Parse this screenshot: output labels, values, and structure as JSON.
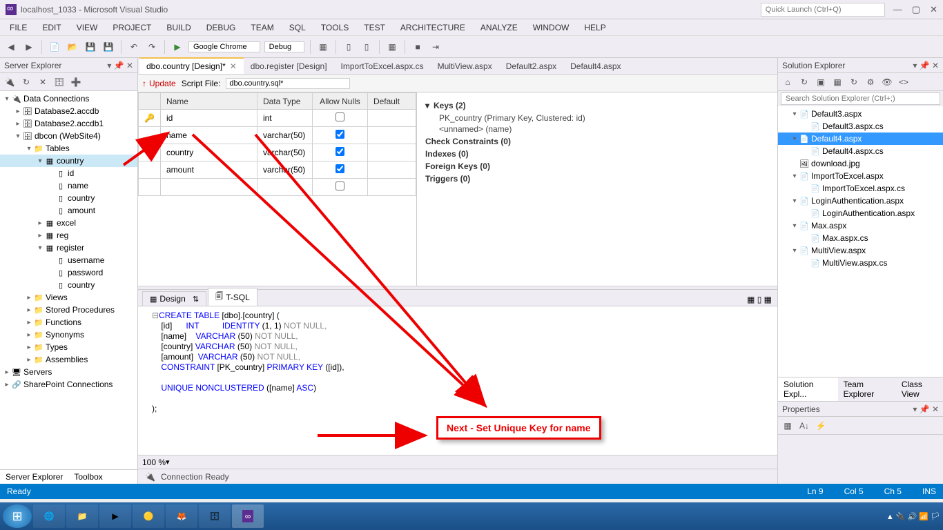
{
  "title": "localhost_1033 - Microsoft Visual Studio",
  "quickLaunch": "Quick Launch (Ctrl+Q)",
  "menu": [
    "FILE",
    "EDIT",
    "VIEW",
    "PROJECT",
    "BUILD",
    "DEBUG",
    "TEAM",
    "SQL",
    "TOOLS",
    "TEST",
    "ARCHITECTURE",
    "ANALYZE",
    "WINDOW",
    "HELP"
  ],
  "runTarget": "Google Chrome",
  "config": "Debug",
  "leftPanel": {
    "title": "Server Explorer",
    "tabs": [
      "Server Explorer",
      "Toolbox"
    ],
    "tree": [
      {
        "d": 0,
        "exp": "▾",
        "ico": "🔌",
        "t": "Data Connections"
      },
      {
        "d": 1,
        "exp": "▸",
        "ico": "🗄",
        "t": "Database2.accdb"
      },
      {
        "d": 1,
        "exp": "▸",
        "ico": "🗄",
        "t": "Database2.accdb1"
      },
      {
        "d": 1,
        "exp": "▾",
        "ico": "🗄",
        "t": "dbcon (WebSite4)"
      },
      {
        "d": 2,
        "exp": "▾",
        "ico": "📁",
        "t": "Tables"
      },
      {
        "d": 3,
        "exp": "▾",
        "ico": "▦",
        "t": "country",
        "sel": true
      },
      {
        "d": 4,
        "exp": "",
        "ico": "▯",
        "t": "id"
      },
      {
        "d": 4,
        "exp": "",
        "ico": "▯",
        "t": "name"
      },
      {
        "d": 4,
        "exp": "",
        "ico": "▯",
        "t": "country"
      },
      {
        "d": 4,
        "exp": "",
        "ico": "▯",
        "t": "amount"
      },
      {
        "d": 3,
        "exp": "▸",
        "ico": "▦",
        "t": "excel"
      },
      {
        "d": 3,
        "exp": "▸",
        "ico": "▦",
        "t": "reg"
      },
      {
        "d": 3,
        "exp": "▾",
        "ico": "▦",
        "t": "register"
      },
      {
        "d": 4,
        "exp": "",
        "ico": "▯",
        "t": "username"
      },
      {
        "d": 4,
        "exp": "",
        "ico": "▯",
        "t": "password"
      },
      {
        "d": 4,
        "exp": "",
        "ico": "▯",
        "t": "country"
      },
      {
        "d": 2,
        "exp": "▸",
        "ico": "📁",
        "t": "Views"
      },
      {
        "d": 2,
        "exp": "▸",
        "ico": "📁",
        "t": "Stored Procedures"
      },
      {
        "d": 2,
        "exp": "▸",
        "ico": "📁",
        "t": "Functions"
      },
      {
        "d": 2,
        "exp": "▸",
        "ico": "📁",
        "t": "Synonyms"
      },
      {
        "d": 2,
        "exp": "▸",
        "ico": "📁",
        "t": "Types"
      },
      {
        "d": 2,
        "exp": "▸",
        "ico": "📁",
        "t": "Assemblies"
      },
      {
        "d": 0,
        "exp": "▸",
        "ico": "🖥",
        "t": "Servers"
      },
      {
        "d": 0,
        "exp": "▸",
        "ico": "🔗",
        "t": "SharePoint Connections"
      }
    ]
  },
  "docTabs": [
    {
      "t": "dbo.country [Design]*",
      "active": true
    },
    {
      "t": "dbo.register [Design]"
    },
    {
      "t": "ImportToExcel.aspx.cs"
    },
    {
      "t": "MultiView.aspx"
    },
    {
      "t": "Default2.aspx"
    },
    {
      "t": "Default4.aspx"
    }
  ],
  "subbar": {
    "update": "Update",
    "scriptLabel": "Script File:",
    "scriptFile": "dbo.country.sql*"
  },
  "cols": {
    "name": "Name",
    "type": "Data Type",
    "nulls": "Allow Nulls",
    "def": "Default"
  },
  "rows": [
    {
      "key": true,
      "name": "id",
      "type": "int",
      "nulls": false
    },
    {
      "key": false,
      "name": "name",
      "type": "varchar(50)",
      "nulls": true
    },
    {
      "key": false,
      "name": "country",
      "type": "varchar(50)",
      "nulls": true
    },
    {
      "key": false,
      "name": "amount",
      "type": "varchar(50)",
      "nulls": true
    }
  ],
  "keys": {
    "hdr": "Keys (2)",
    "items": [
      "PK_country (Primary Key, Clustered: id)",
      "<unnamed> (name)"
    ],
    "cc": "Check Constraints (0)",
    "idx": "Indexes (0)",
    "fk": "Foreign Keys (0)",
    "trg": "Triggers (0)"
  },
  "sqlTabs": {
    "design": "Design",
    "tsql": "T-SQL"
  },
  "sql": {
    "l1a": "CREATE TABLE ",
    "l1b": "[dbo].[country] (",
    "l2a": "    [id]      ",
    "l2b": "INT",
    "l2c": "          IDENTITY ",
    "l2d": "(1, 1)",
    "l2e": " NOT NULL,",
    "l3a": "    [name]    ",
    "l3b": "VARCHAR ",
    "l3c": "(50)",
    "l3d": " NOT NULL,",
    "l4a": "    [country] ",
    "l4b": "VARCHAR ",
    "l4c": "(50)",
    "l4d": " NOT NULL,",
    "l5a": "    [amount]  ",
    "l5b": "VARCHAR ",
    "l5c": "(50)",
    "l5d": " NOT NULL,",
    "l6a": "    CONSTRAINT ",
    "l6b": "[PK_country]",
    "l6c": " PRIMARY KEY ",
    "l6d": "([id]),",
    "l7": "",
    "l8a": "    UNIQUE NONCLUSTERED ",
    "l8b": "([name] ",
    "l8c": "ASC",
    "l8d": ")",
    "l9": "",
    "l10": ");"
  },
  "zoom": "100 %",
  "connStatus": "Connection Ready",
  "statusbar": {
    "ready": "Ready",
    "ln": "Ln 9",
    "col": "Col 5",
    "ch": "Ch 5",
    "ins": "INS"
  },
  "rightPanel": {
    "title": "Solution Explorer",
    "search": "Search Solution Explorer (Ctrl+;)",
    "tabs": [
      "Solution Expl...",
      "Team Explorer",
      "Class View"
    ],
    "tree": [
      {
        "d": 0,
        "exp": "▾",
        "ico": "📄",
        "t": "Default3.aspx"
      },
      {
        "d": 1,
        "exp": "",
        "ico": "📄",
        "t": "Default3.aspx.cs"
      },
      {
        "d": 0,
        "exp": "▾",
        "ico": "📄",
        "t": "Default4.aspx",
        "sel": true
      },
      {
        "d": 1,
        "exp": "",
        "ico": "📄",
        "t": "Default4.aspx.cs"
      },
      {
        "d": 0,
        "exp": "",
        "ico": "🖼",
        "t": "download.jpg"
      },
      {
        "d": 0,
        "exp": "▾",
        "ico": "📄",
        "t": "ImportToExcel.aspx"
      },
      {
        "d": 1,
        "exp": "",
        "ico": "📄",
        "t": "ImportToExcel.aspx.cs"
      },
      {
        "d": 0,
        "exp": "▾",
        "ico": "📄",
        "t": "LoginAuthentication.aspx"
      },
      {
        "d": 1,
        "exp": "",
        "ico": "📄",
        "t": "LoginAuthentication.aspx"
      },
      {
        "d": 0,
        "exp": "▾",
        "ico": "📄",
        "t": "Max.aspx"
      },
      {
        "d": 1,
        "exp": "",
        "ico": "📄",
        "t": "Max.aspx.cs"
      },
      {
        "d": 0,
        "exp": "▾",
        "ico": "📄",
        "t": "MultiView.aspx"
      },
      {
        "d": 1,
        "exp": "",
        "ico": "📄",
        "t": "MultiView.aspx.cs"
      }
    ],
    "props": "Properties"
  },
  "annotation": "Next - Set Unique Key for name"
}
